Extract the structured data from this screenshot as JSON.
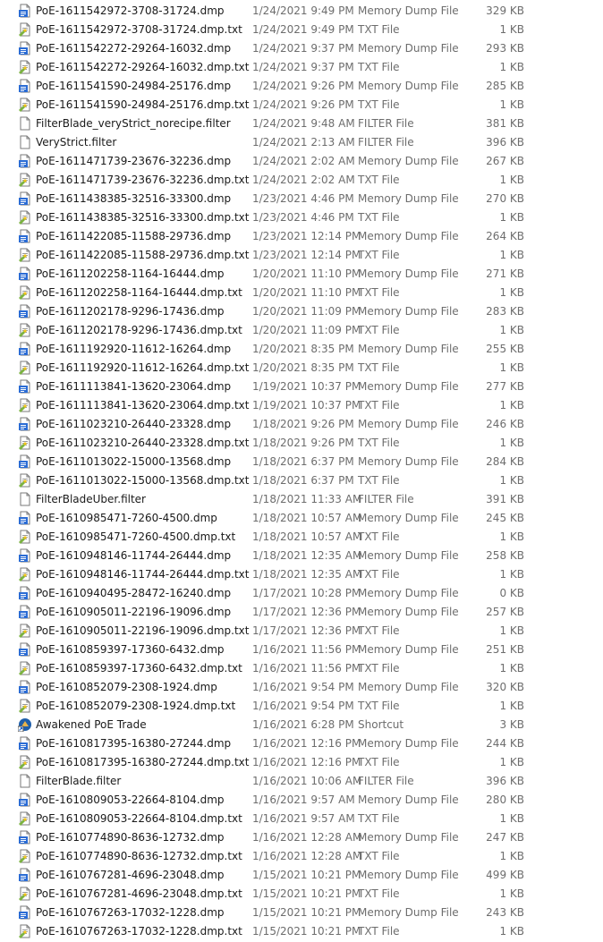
{
  "files": [
    {
      "name": "PoE-1611542972-3708-31724.dmp",
      "date": "1/24/2021 9:49 PM",
      "type": "Memory Dump File",
      "size": "329 KB",
      "icon": "dmp-file-icon"
    },
    {
      "name": "PoE-1611542972-3708-31724.dmp.txt",
      "date": "1/24/2021 9:49 PM",
      "type": "TXT File",
      "size": "1 KB",
      "icon": "txt-file-icon"
    },
    {
      "name": "PoE-1611542272-29264-16032.dmp",
      "date": "1/24/2021 9:37 PM",
      "type": "Memory Dump File",
      "size": "293 KB",
      "icon": "dmp-file-icon"
    },
    {
      "name": "PoE-1611542272-29264-16032.dmp.txt",
      "date": "1/24/2021 9:37 PM",
      "type": "TXT File",
      "size": "1 KB",
      "icon": "txt-file-icon"
    },
    {
      "name": "PoE-1611541590-24984-25176.dmp",
      "date": "1/24/2021 9:26 PM",
      "type": "Memory Dump File",
      "size": "285 KB",
      "icon": "dmp-file-icon"
    },
    {
      "name": "PoE-1611541590-24984-25176.dmp.txt",
      "date": "1/24/2021 9:26 PM",
      "type": "TXT File",
      "size": "1 KB",
      "icon": "txt-file-icon"
    },
    {
      "name": "FilterBlade_veryStrict_norecipe.filter",
      "date": "1/24/2021 9:48 AM",
      "type": "FILTER File",
      "size": "381 KB",
      "icon": "filter-file-icon"
    },
    {
      "name": "VeryStrict.filter",
      "date": "1/24/2021 2:13 AM",
      "type": "FILTER File",
      "size": "396 KB",
      "icon": "filter-file-icon"
    },
    {
      "name": "PoE-1611471739-23676-32236.dmp",
      "date": "1/24/2021 2:02 AM",
      "type": "Memory Dump File",
      "size": "267 KB",
      "icon": "dmp-file-icon"
    },
    {
      "name": "PoE-1611471739-23676-32236.dmp.txt",
      "date": "1/24/2021 2:02 AM",
      "type": "TXT File",
      "size": "1 KB",
      "icon": "txt-file-icon"
    },
    {
      "name": "PoE-1611438385-32516-33300.dmp",
      "date": "1/23/2021 4:46 PM",
      "type": "Memory Dump File",
      "size": "270 KB",
      "icon": "dmp-file-icon"
    },
    {
      "name": "PoE-1611438385-32516-33300.dmp.txt",
      "date": "1/23/2021 4:46 PM",
      "type": "TXT File",
      "size": "1 KB",
      "icon": "txt-file-icon"
    },
    {
      "name": "PoE-1611422085-11588-29736.dmp",
      "date": "1/23/2021 12:14 PM",
      "type": "Memory Dump File",
      "size": "264 KB",
      "icon": "dmp-file-icon"
    },
    {
      "name": "PoE-1611422085-11588-29736.dmp.txt",
      "date": "1/23/2021 12:14 PM",
      "type": "TXT File",
      "size": "1 KB",
      "icon": "txt-file-icon"
    },
    {
      "name": "PoE-1611202258-1164-16444.dmp",
      "date": "1/20/2021 11:10 PM",
      "type": "Memory Dump File",
      "size": "271 KB",
      "icon": "dmp-file-icon"
    },
    {
      "name": "PoE-1611202258-1164-16444.dmp.txt",
      "date": "1/20/2021 11:10 PM",
      "type": "TXT File",
      "size": "1 KB",
      "icon": "txt-file-icon"
    },
    {
      "name": "PoE-1611202178-9296-17436.dmp",
      "date": "1/20/2021 11:09 PM",
      "type": "Memory Dump File",
      "size": "283 KB",
      "icon": "dmp-file-icon"
    },
    {
      "name": "PoE-1611202178-9296-17436.dmp.txt",
      "date": "1/20/2021 11:09 PM",
      "type": "TXT File",
      "size": "1 KB",
      "icon": "txt-file-icon"
    },
    {
      "name": "PoE-1611192920-11612-16264.dmp",
      "date": "1/20/2021 8:35 PM",
      "type": "Memory Dump File",
      "size": "255 KB",
      "icon": "dmp-file-icon"
    },
    {
      "name": "PoE-1611192920-11612-16264.dmp.txt",
      "date": "1/20/2021 8:35 PM",
      "type": "TXT File",
      "size": "1 KB",
      "icon": "txt-file-icon"
    },
    {
      "name": "PoE-1611113841-13620-23064.dmp",
      "date": "1/19/2021 10:37 PM",
      "type": "Memory Dump File",
      "size": "277 KB",
      "icon": "dmp-file-icon"
    },
    {
      "name": "PoE-1611113841-13620-23064.dmp.txt",
      "date": "1/19/2021 10:37 PM",
      "type": "TXT File",
      "size": "1 KB",
      "icon": "txt-file-icon"
    },
    {
      "name": "PoE-1611023210-26440-23328.dmp",
      "date": "1/18/2021 9:26 PM",
      "type": "Memory Dump File",
      "size": "246 KB",
      "icon": "dmp-file-icon"
    },
    {
      "name": "PoE-1611023210-26440-23328.dmp.txt",
      "date": "1/18/2021 9:26 PM",
      "type": "TXT File",
      "size": "1 KB",
      "icon": "txt-file-icon"
    },
    {
      "name": "PoE-1611013022-15000-13568.dmp",
      "date": "1/18/2021 6:37 PM",
      "type": "Memory Dump File",
      "size": "284 KB",
      "icon": "dmp-file-icon"
    },
    {
      "name": "PoE-1611013022-15000-13568.dmp.txt",
      "date": "1/18/2021 6:37 PM",
      "type": "TXT File",
      "size": "1 KB",
      "icon": "txt-file-icon"
    },
    {
      "name": "FilterBladeUber.filter",
      "date": "1/18/2021 11:33 AM",
      "type": "FILTER File",
      "size": "391 KB",
      "icon": "filter-file-icon"
    },
    {
      "name": "PoE-1610985471-7260-4500.dmp",
      "date": "1/18/2021 10:57 AM",
      "type": "Memory Dump File",
      "size": "245 KB",
      "icon": "dmp-file-icon"
    },
    {
      "name": "PoE-1610985471-7260-4500.dmp.txt",
      "date": "1/18/2021 10:57 AM",
      "type": "TXT File",
      "size": "1 KB",
      "icon": "txt-file-icon"
    },
    {
      "name": "PoE-1610948146-11744-26444.dmp",
      "date": "1/18/2021 12:35 AM",
      "type": "Memory Dump File",
      "size": "258 KB",
      "icon": "dmp-file-icon"
    },
    {
      "name": "PoE-1610948146-11744-26444.dmp.txt",
      "date": "1/18/2021 12:35 AM",
      "type": "TXT File",
      "size": "1 KB",
      "icon": "txt-file-icon"
    },
    {
      "name": "PoE-1610940495-28472-16240.dmp",
      "date": "1/17/2021 10:28 PM",
      "type": "Memory Dump File",
      "size": "0 KB",
      "icon": "dmp-file-icon"
    },
    {
      "name": "PoE-1610905011-22196-19096.dmp",
      "date": "1/17/2021 12:36 PM",
      "type": "Memory Dump File",
      "size": "257 KB",
      "icon": "dmp-file-icon"
    },
    {
      "name": "PoE-1610905011-22196-19096.dmp.txt",
      "date": "1/17/2021 12:36 PM",
      "type": "TXT File",
      "size": "1 KB",
      "icon": "txt-file-icon"
    },
    {
      "name": "PoE-1610859397-17360-6432.dmp",
      "date": "1/16/2021 11:56 PM",
      "type": "Memory Dump File",
      "size": "251 KB",
      "icon": "dmp-file-icon"
    },
    {
      "name": "PoE-1610859397-17360-6432.dmp.txt",
      "date": "1/16/2021 11:56 PM",
      "type": "TXT File",
      "size": "1 KB",
      "icon": "txt-file-icon"
    },
    {
      "name": "PoE-1610852079-2308-1924.dmp",
      "date": "1/16/2021 9:54 PM",
      "type": "Memory Dump File",
      "size": "320 KB",
      "icon": "dmp-file-icon"
    },
    {
      "name": "PoE-1610852079-2308-1924.dmp.txt",
      "date": "1/16/2021 9:54 PM",
      "type": "TXT File",
      "size": "1 KB",
      "icon": "txt-file-icon"
    },
    {
      "name": "Awakened PoE Trade",
      "date": "1/16/2021 6:28 PM",
      "type": "Shortcut",
      "size": "3 KB",
      "icon": "shortcut-icon"
    },
    {
      "name": "PoE-1610817395-16380-27244.dmp",
      "date": "1/16/2021 12:16 PM",
      "type": "Memory Dump File",
      "size": "244 KB",
      "icon": "dmp-file-icon"
    },
    {
      "name": "PoE-1610817395-16380-27244.dmp.txt",
      "date": "1/16/2021 12:16 PM",
      "type": "TXT File",
      "size": "1 KB",
      "icon": "txt-file-icon"
    },
    {
      "name": "FilterBlade.filter",
      "date": "1/16/2021 10:06 AM",
      "type": "FILTER File",
      "size": "396 KB",
      "icon": "filter-file-icon"
    },
    {
      "name": "PoE-1610809053-22664-8104.dmp",
      "date": "1/16/2021 9:57 AM",
      "type": "Memory Dump File",
      "size": "280 KB",
      "icon": "dmp-file-icon"
    },
    {
      "name": "PoE-1610809053-22664-8104.dmp.txt",
      "date": "1/16/2021 9:57 AM",
      "type": "TXT File",
      "size": "1 KB",
      "icon": "txt-file-icon"
    },
    {
      "name": "PoE-1610774890-8636-12732.dmp",
      "date": "1/16/2021 12:28 AM",
      "type": "Memory Dump File",
      "size": "247 KB",
      "icon": "dmp-file-icon"
    },
    {
      "name": "PoE-1610774890-8636-12732.dmp.txt",
      "date": "1/16/2021 12:28 AM",
      "type": "TXT File",
      "size": "1 KB",
      "icon": "txt-file-icon"
    },
    {
      "name": "PoE-1610767281-4696-23048.dmp",
      "date": "1/15/2021 10:21 PM",
      "type": "Memory Dump File",
      "size": "499 KB",
      "icon": "dmp-file-icon"
    },
    {
      "name": "PoE-1610767281-4696-23048.dmp.txt",
      "date": "1/15/2021 10:21 PM",
      "type": "TXT File",
      "size": "1 KB",
      "icon": "txt-file-icon"
    },
    {
      "name": "PoE-1610767263-17032-1228.dmp",
      "date": "1/15/2021 10:21 PM",
      "type": "Memory Dump File",
      "size": "243 KB",
      "icon": "dmp-file-icon"
    },
    {
      "name": "PoE-1610767263-17032-1228.dmp.txt",
      "date": "1/15/2021 10:21 PM",
      "type": "TXT File",
      "size": "1 KB",
      "icon": "txt-file-icon"
    }
  ],
  "colors": {
    "background": "#ffffff",
    "name_text": "#1a1a1a",
    "meta_text": "#6d6d6d",
    "dmp_icon": "#2b6cd4",
    "txt_icon_accent": "#7cb342",
    "shortcut_icon": "#1f5faa"
  }
}
